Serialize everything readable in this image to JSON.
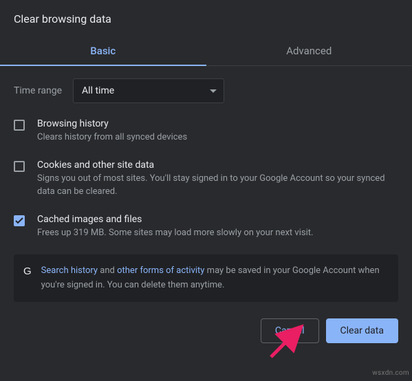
{
  "dialog": {
    "title": "Clear browsing data",
    "tabs": {
      "basic": "Basic",
      "advanced": "Advanced"
    },
    "time": {
      "label": "Time range",
      "value": "All time"
    },
    "options": {
      "browsing": {
        "title": "Browsing history",
        "desc": "Clears history from all synced devices",
        "checked": false
      },
      "cookies": {
        "title": "Cookies and other site data",
        "desc": "Signs you out of most sites. You'll stay signed in to your Google Account so your synced data can be cleared.",
        "checked": false
      },
      "cache": {
        "title": "Cached images and files",
        "desc": "Frees up 319 MB. Some sites may load more slowly on your next visit.",
        "checked": true
      }
    },
    "info": {
      "link1": "Search history",
      "mid1": " and ",
      "link2": "other forms of activity",
      "rest": " may be saved in your Google Account when you're signed in. You can delete them anytime."
    },
    "buttons": {
      "cancel": "Cancel",
      "clear": "Clear data"
    }
  },
  "watermark": "wsxdn.com"
}
